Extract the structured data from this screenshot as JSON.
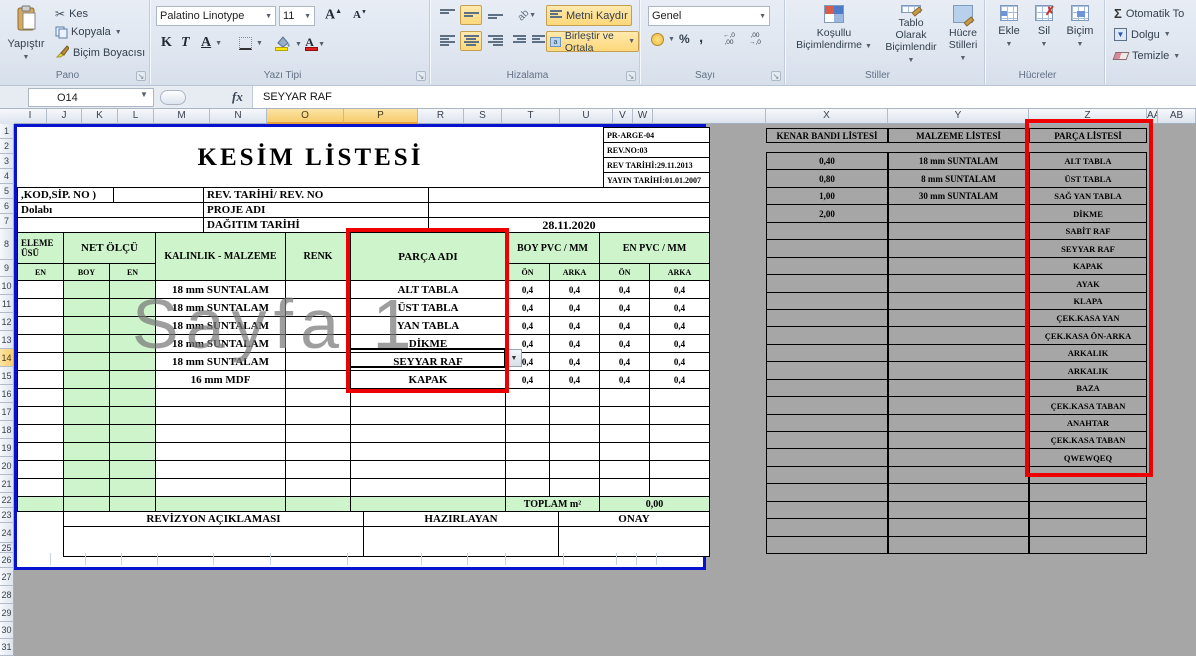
{
  "ribbon": {
    "clipboard": {
      "paste": "Yapıştır",
      "cut": "Kes",
      "copy": "Kopyala",
      "painter": "Biçim Boyacısı",
      "group": "Pano"
    },
    "font": {
      "name": "Palatino Linotype",
      "size": "11",
      "bold": "K",
      "italic": "T",
      "underline": "A",
      "group": "Yazı Tipi"
    },
    "align": {
      "wrap": "Metni Kaydır",
      "merge": "Birleştir ve Ortala",
      "orientation_glyph": "ab",
      "group": "Hizalama"
    },
    "number": {
      "format": "Genel",
      "percent_glyph": "%",
      "comma_glyph": ",",
      "inc_top": "←,0",
      "inc_bot": ",00",
      "dec_top": ",00",
      "dec_bot": "→,0",
      "group": "Sayı"
    },
    "styles": {
      "cond1": "Koşullu",
      "cond2": "Biçimlendirme",
      "tbl1": "Tablo Olarak",
      "tbl2": "Biçimlendir",
      "cs1": "Hücre",
      "cs2": "Stilleri",
      "group": "Stiller"
    },
    "cells": {
      "insert": "Ekle",
      "del": "Sil",
      "format": "Biçim",
      "group": "Hücreler"
    },
    "edit": {
      "sigma": "Σ",
      "autosum": "Otomatik To",
      "fill": "Dolgu",
      "clear": "Temizle"
    }
  },
  "formula_bar": {
    "name_box": "O14",
    "fx": "fx",
    "value": "SEYYAR RAF"
  },
  "grid": {
    "columns": [
      "I",
      "J",
      "K",
      "L",
      "M",
      "N",
      "O",
      "P",
      "R",
      "S",
      "T",
      "U",
      "V",
      "W",
      "",
      "X",
      "Y",
      "Z",
      "AA",
      "AB"
    ],
    "selected_columns": [
      "O",
      "P"
    ],
    "selected_row": 14,
    "row_count": 31
  },
  "sheet": {
    "title": "KESİM LİSTESİ",
    "doc_info": [
      "PR-ARGE-04",
      "REV.NO:03",
      "REV TARİHİ:29.11.2013",
      "YAYIN TARİHİ:01.01.2007"
    ],
    "info": {
      "r5c1": ",KOD,SİP. NO )",
      "r5c3": "REV. TARİHİ/ REV. NO",
      "r6c1": "Dolabı",
      "r6c2": "PROJE ADI",
      "r7c2": "DAĞITIM TARİHİ",
      "r7c3": "28.11.2020"
    },
    "header": {
      "c1": "ELEME ÜSÜ",
      "net": "NET ÖLÇÜ",
      "kalinlik": "KALINLIK - MALZEME",
      "renk": "RENK",
      "parca": "PARÇA ADI",
      "boypvc": "BOY PVC / MM",
      "enpvc": "EN PVC / MM",
      "sub_en": "EN",
      "sub_boy": "BOY",
      "sub_on": "ÖN",
      "sub_arka": "ARKA"
    },
    "rows": [
      {
        "material": "18 mm SUNTALAM",
        "part": "ALT TABLA",
        "pvc": [
          "0,4",
          "0,4",
          "0,4",
          "0,4"
        ],
        "active": false
      },
      {
        "material": "18 mm SUNTALAM",
        "part": "ÜST TABLA",
        "pvc": [
          "0,4",
          "0,4",
          "0,4",
          "0,4"
        ],
        "active": false
      },
      {
        "material": "18 mm SUNTALAM",
        "part": "YAN TABLA",
        "pvc": [
          "0,4",
          "0,4",
          "0,4",
          "0,4"
        ],
        "active": false
      },
      {
        "material": "18 mm SUNTALAM",
        "part": "DİKME",
        "pvc": [
          "0,4",
          "0,4",
          "0,4",
          "0,4"
        ],
        "active": false
      },
      {
        "material": "18 mm SUNTALAM",
        "part": "SEYYAR RAF",
        "pvc": [
          "0,4",
          "0,4",
          "0,4",
          "0,4"
        ],
        "active": true
      },
      {
        "material": "16 mm MDF",
        "part": "KAPAK",
        "pvc": [
          "0,4",
          "0,4",
          "0,4",
          "0,4"
        ],
        "active": false
      }
    ],
    "toplam_label": "TOPLAM m²",
    "toplam_value": "0,00",
    "footer": {
      "rev": "REVİZYON AÇIKLAMASI",
      "haz": "HAZIRLAYAN",
      "onay": "ONAY"
    }
  },
  "side_lists": {
    "kenar": {
      "title": "KENAR BANDI LİSTESİ",
      "values": [
        "0,40",
        "0,80",
        "1,00",
        "2,00"
      ]
    },
    "malzeme": {
      "title": "MALZEME LİSTESİ",
      "values": [
        "18 mm SUNTALAM",
        "8 mm SUNTALAM",
        "30 mm SUNTALAM"
      ]
    },
    "parca": {
      "title": "PARÇA LİSTESİ",
      "values": [
        "ALT TABLA",
        "ÜST TABLA",
        "SAĞ YAN TABLA",
        "DİKME",
        "SABİT RAF",
        "SEYYAR RAF",
        "KAPAK",
        "AYAK",
        "KLAPA",
        "ÇEK.KASA YAN",
        "ÇEK.KASA ÖN-ARKA",
        "ARKALIK",
        "ARKALIK",
        "BAZA",
        "ÇEK.KASA TABAN",
        "ANAHTAR",
        "ÇEK.KASA TABAN",
        "QWEWQEQ"
      ]
    }
  },
  "watermark": "Sayfa 1"
}
